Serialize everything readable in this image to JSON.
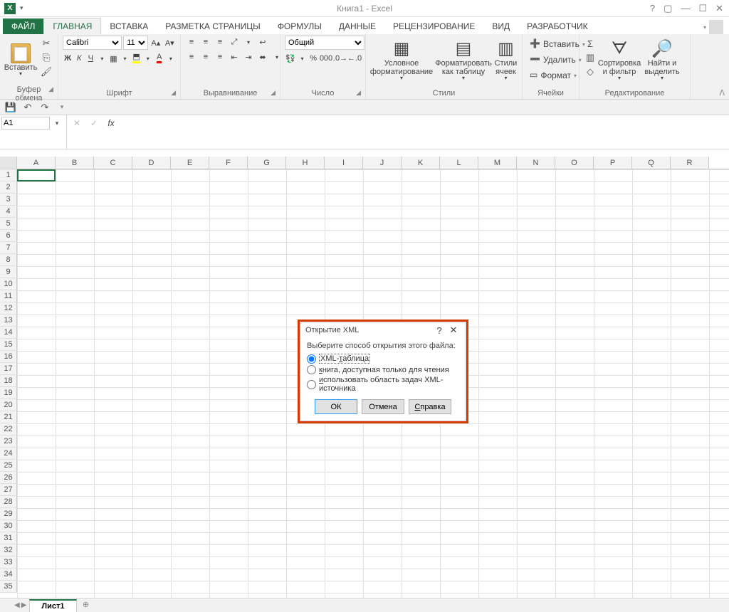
{
  "title": "Книга1 - Excel",
  "tabs": {
    "file": "ФАЙЛ",
    "home": "ГЛАВНАЯ",
    "insert": "ВСТАВКА",
    "layout": "РАЗМЕТКА СТРАНИЦЫ",
    "formulas": "ФОРМУЛЫ",
    "data": "ДАННЫЕ",
    "review": "РЕЦЕНЗИРОВАНИЕ",
    "view": "ВИД",
    "developer": "РАЗРАБОТЧИК"
  },
  "groups": {
    "clipboard": "Буфер обмена",
    "font": "Шрифт",
    "alignment": "Выравнивание",
    "number": "Число",
    "styles": "Стили",
    "cells": "Ячейки",
    "editing": "Редактирование",
    "paste": "Вставить"
  },
  "font": {
    "name": "Calibri",
    "size": "11"
  },
  "numberFormat": "Общий",
  "styles": {
    "conditional": "Условное форматирование",
    "table": "Форматировать как таблицу",
    "cell": "Стили ячеек"
  },
  "cells": {
    "insert": "Вставить",
    "delete": "Удалить",
    "format": "Формат"
  },
  "editing": {
    "sort": "Сортировка и фильтр",
    "find": "Найти и выделить"
  },
  "namebox": "A1",
  "sheet": "Лист1",
  "cols": [
    "A",
    "B",
    "C",
    "D",
    "E",
    "F",
    "G",
    "H",
    "I",
    "J",
    "K",
    "L",
    "M",
    "N",
    "O",
    "P",
    "Q",
    "R"
  ],
  "rowCount": 35,
  "dialog": {
    "title": "Открытие XML",
    "prompt": "Выберите способ открытия этого файла:",
    "opt1": "XML-таблица",
    "opt2": "книга, доступная только для чтения",
    "opt3": "использовать область задач XML-источника",
    "ok": "ОК",
    "cancel": "Отмена",
    "help": "Справка"
  }
}
